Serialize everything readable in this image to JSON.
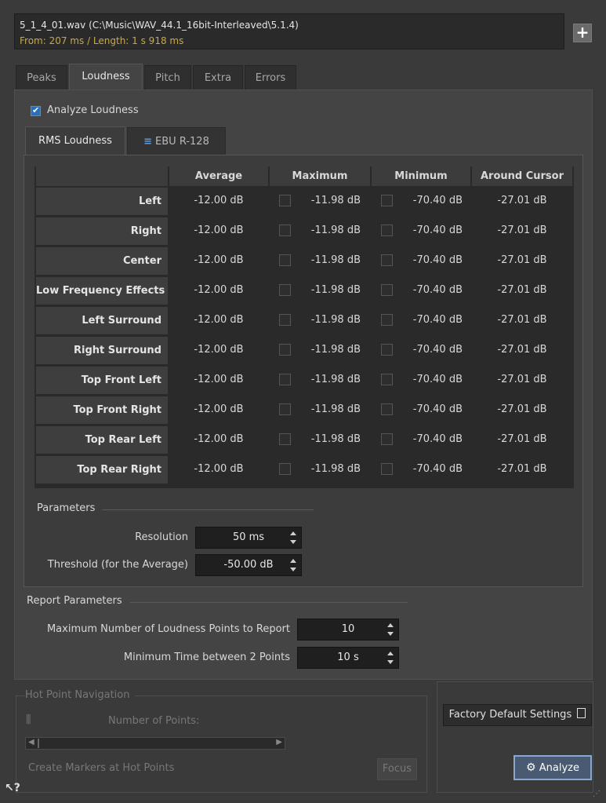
{
  "file": {
    "name": "5_1_4_01.wav (C:\\Music\\WAV_44.1_16bit-Interleaved\\5.1.4)",
    "range": "From: 207 ms / Length: 1 s 918 ms",
    "add_label": "+"
  },
  "tabs": [
    "Peaks",
    "Loudness",
    "Pitch",
    "Extra",
    "Errors"
  ],
  "analyze_loudness": {
    "label": "Analyze Loudness",
    "checked": true
  },
  "subtabs": [
    "RMS Loudness",
    "EBU R-128"
  ],
  "table": {
    "columns": [
      "Average",
      "Maximum",
      "Minimum",
      "Around Cursor"
    ],
    "rows": [
      {
        "name": "Left",
        "average": "-12.00 dB",
        "maximum": "-11.98 dB",
        "minimum": "-70.40 dB",
        "cursor": "-27.01 dB"
      },
      {
        "name": "Right",
        "average": "-12.00 dB",
        "maximum": "-11.98 dB",
        "minimum": "-70.40 dB",
        "cursor": "-27.01 dB"
      },
      {
        "name": "Center",
        "average": "-12.00 dB",
        "maximum": "-11.98 dB",
        "minimum": "-70.40 dB",
        "cursor": "-27.01 dB"
      },
      {
        "name": "Low Frequency Effects",
        "average": "-12.00 dB",
        "maximum": "-11.98 dB",
        "minimum": "-70.40 dB",
        "cursor": "-27.01 dB"
      },
      {
        "name": "Left Surround",
        "average": "-12.00 dB",
        "maximum": "-11.98 dB",
        "minimum": "-70.40 dB",
        "cursor": "-27.01 dB"
      },
      {
        "name": "Right Surround",
        "average": "-12.00 dB",
        "maximum": "-11.98 dB",
        "minimum": "-70.40 dB",
        "cursor": "-27.01 dB"
      },
      {
        "name": "Top Front Left",
        "average": "-12.00 dB",
        "maximum": "-11.98 dB",
        "minimum": "-70.40 dB",
        "cursor": "-27.01 dB"
      },
      {
        "name": "Top Front Right",
        "average": "-12.00 dB",
        "maximum": "-11.98 dB",
        "minimum": "-70.40 dB",
        "cursor": "-27.01 dB"
      },
      {
        "name": "Top Rear Left",
        "average": "-12.00 dB",
        "maximum": "-11.98 dB",
        "minimum": "-70.40 dB",
        "cursor": "-27.01 dB"
      },
      {
        "name": "Top Rear Right",
        "average": "-12.00 dB",
        "maximum": "-11.98 dB",
        "minimum": "-70.40 dB",
        "cursor": "-27.01 dB"
      }
    ]
  },
  "parameters": {
    "title": "Parameters",
    "resolution_label": "Resolution",
    "resolution_value": "50 ms",
    "threshold_label": "Threshold (for the Average)",
    "threshold_value": "-50.00 dB"
  },
  "report": {
    "title": "Report Parameters",
    "max_points_label": "Maximum Number of Loudness Points to Report",
    "max_points_value": "10",
    "min_time_label": "Minimum Time between 2 Points",
    "min_time_value": "10 s"
  },
  "hot_points": {
    "title": "Hot Point Navigation",
    "count_label": "Number of Points:",
    "create_markers_label": "Create Markers at Hot Points",
    "focus_label": "Focus"
  },
  "buttons": {
    "factory_default": "Factory Default Settings",
    "analyze": "Analyze",
    "help": "?"
  },
  "colors": {
    "background": "#3a3a3a",
    "range_text": "#c8a84a",
    "checkbox": "#2b6fb5",
    "analyze_border": "#89a8d0"
  }
}
